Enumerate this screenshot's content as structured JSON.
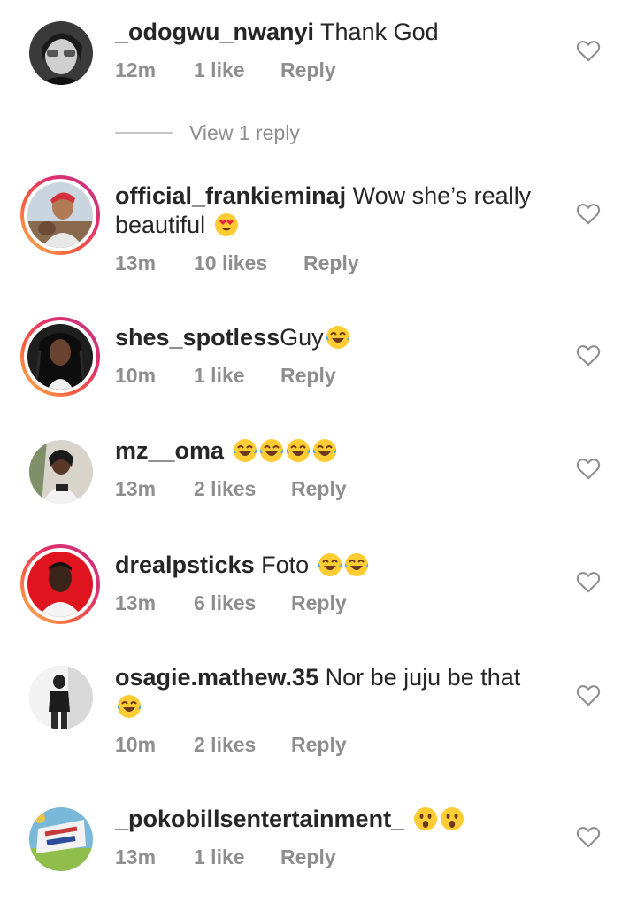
{
  "view_replies_label": "View 1 reply",
  "comments": [
    {
      "username": "_odogwu_nwanyi",
      "text": "Thank God",
      "emojis": [],
      "time": "12m",
      "likes": "1 like",
      "reply": "Reply",
      "story_ring": false
    },
    {
      "username": "official_frankieminaj",
      "text": "Wow she’s really beautiful",
      "emojis": [
        "heart-eyes-emoji"
      ],
      "time": "13m",
      "likes": "10 likes",
      "reply": "Reply",
      "story_ring": true
    },
    {
      "username": "shes_spotless",
      "text": "Guy",
      "emojis": [
        "tears-of-joy-emoji"
      ],
      "time": "10m",
      "likes": "1 like",
      "reply": "Reply",
      "story_ring": true
    },
    {
      "username": "mz__oma",
      "text": "",
      "emojis": [
        "tears-of-joy-emoji",
        "tears-of-joy-emoji",
        "tears-of-joy-emoji",
        "tears-of-joy-emoji"
      ],
      "time": "13m",
      "likes": "2 likes",
      "reply": "Reply",
      "story_ring": false
    },
    {
      "username": "drealpsticks",
      "text": "Foto",
      "emojis": [
        "tears-of-joy-emoji",
        "tears-of-joy-emoji"
      ],
      "time": "13m",
      "likes": "6 likes",
      "reply": "Reply",
      "story_ring": true
    },
    {
      "username": "osagie.mathew.35",
      "text": "Nor be juju be that",
      "emojis": [
        "tears-of-joy-emoji"
      ],
      "time": "10m",
      "likes": "2 likes",
      "reply": "Reply",
      "story_ring": false
    },
    {
      "username": "_pokobillsentertainment_",
      "text": "",
      "emojis": [
        "astonished-emoji",
        "astonished-emoji"
      ],
      "time": "13m",
      "likes": "1 like",
      "reply": "Reply",
      "story_ring": false
    }
  ],
  "colors": {
    "text": "#262626",
    "meta": "#8e8e8e",
    "heart_outline": "#8e8e8e",
    "story_ring_start": "#fdc054",
    "story_ring_end": "#c13584"
  }
}
